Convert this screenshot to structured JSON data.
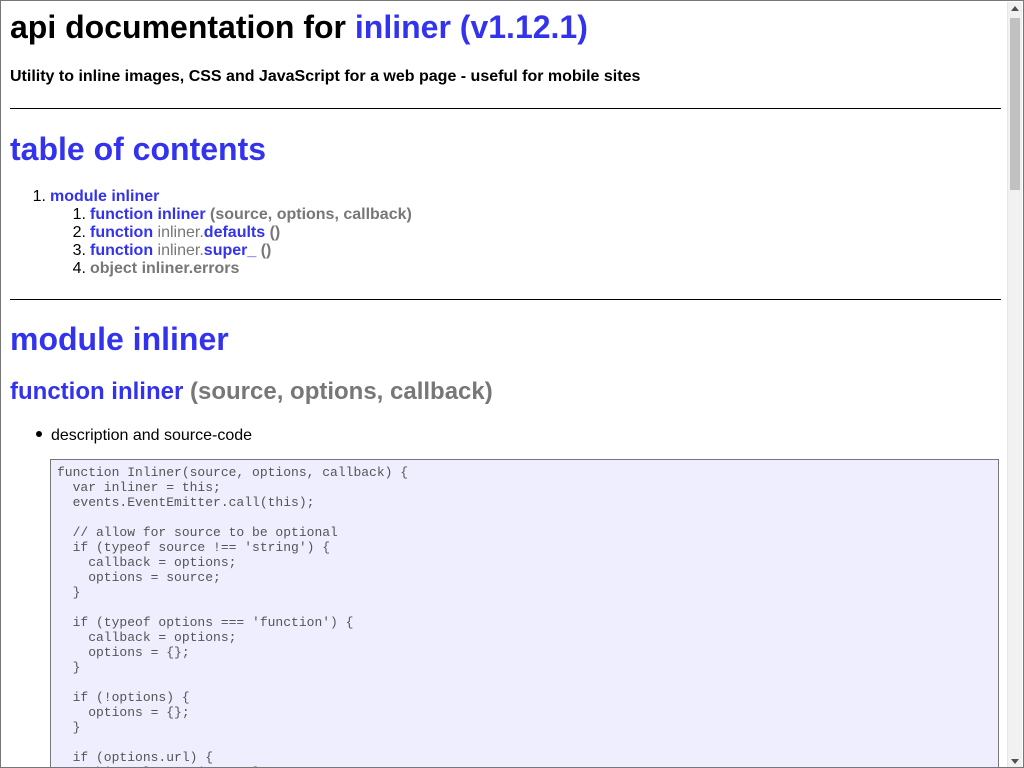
{
  "header": {
    "title_prefix": "api documentation for",
    "title_link": "inliner (v1.12.1)",
    "description": "Utility to inline images, CSS and JavaScript for a web page - useful for mobile sites"
  },
  "toc": {
    "heading": "table of contents",
    "items": [
      {
        "num": "1.",
        "keyword": "module inliner"
      },
      {
        "num": "1.",
        "keyword": "function inliner",
        "signature": "(source, options, callback)"
      },
      {
        "num": "2.",
        "keyword": "function",
        "object": "inliner.",
        "member": "defaults",
        "signature": "()"
      },
      {
        "num": "3.",
        "keyword": "function",
        "object": "inliner.",
        "member": "super_",
        "signature": "()"
      },
      {
        "num": "4.",
        "label": "object inliner.errors"
      }
    ]
  },
  "module": {
    "heading": "module inliner",
    "function_keyword": "function inliner",
    "function_signature": "(source, options, callback)",
    "bullet": "description and source-code",
    "code": "function Inliner(source, options, callback) {\n  var inliner = this;\n  events.EventEmitter.call(this);\n\n  // allow for source to be optional\n  if (typeof source !== 'string') {\n    callback = options;\n    options = source;\n  }\n\n  if (typeof options === 'function') {\n    callback = options;\n    options = {};\n  }\n\n  if (!options) {\n    options = {};\n  }\n\n  if (options.url) {\n    this.url = options.url;"
  },
  "colors": {
    "link": "#3333ee",
    "muted": "#777777",
    "code_bg": "#eeeeff"
  }
}
